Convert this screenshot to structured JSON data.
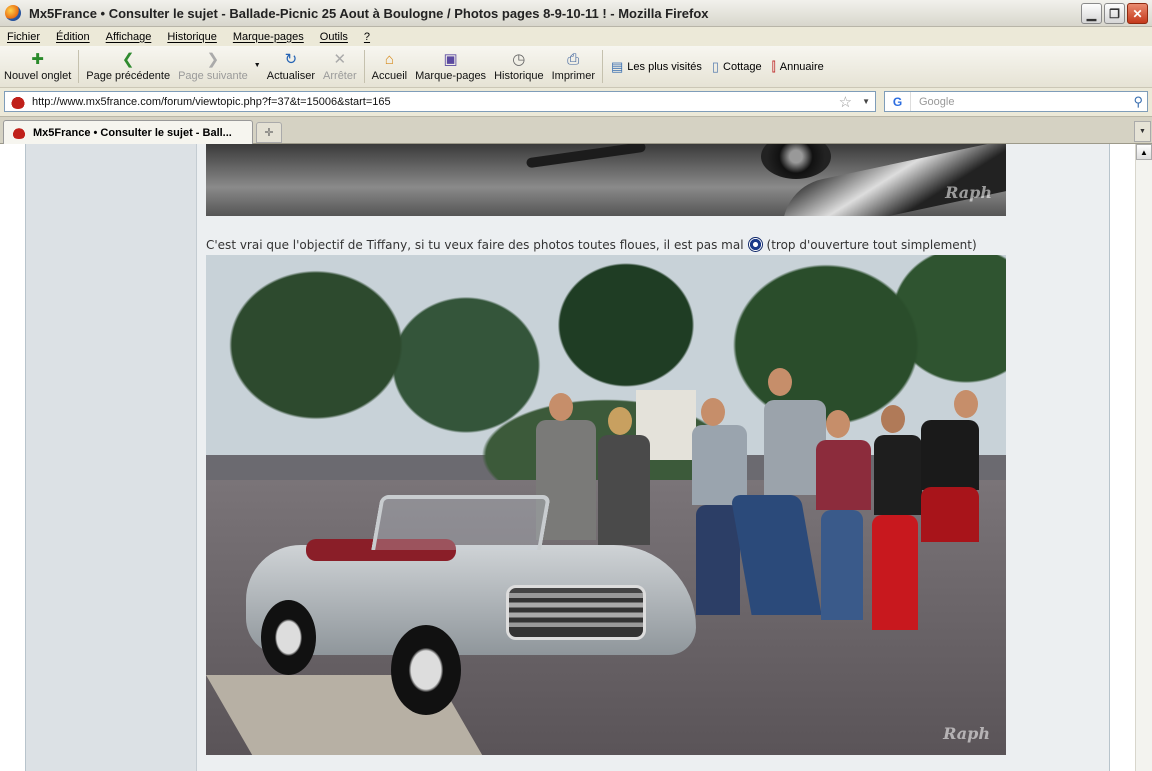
{
  "window": {
    "title": "Mx5France • Consulter le sujet - Ballade-Picnic 25 Aout à Boulogne / Photos pages 8-9-10-11 ! - Mozilla Firefox"
  },
  "menu": [
    "Fichier",
    "Édition",
    "Affichage",
    "Historique",
    "Marque-pages",
    "Outils",
    "?"
  ],
  "toolbar": {
    "new_tab": "Nouvel onglet",
    "back": "Page précédente",
    "forward": "Page suivante",
    "reload": "Actualiser",
    "stop": "Arrêter",
    "home": "Accueil",
    "bookmarks": "Marque-pages",
    "history": "Historique",
    "print": "Imprimer"
  },
  "bookmarks_bar": [
    "Les plus visités",
    "Cottage",
    "Annuaire"
  ],
  "address": {
    "url": "http://www.mx5france.com/forum/viewtopic.php?f=37&t=15006&start=165"
  },
  "search": {
    "placeholder": "Google"
  },
  "tab": {
    "title": "Mx5France • Consulter le sujet - Ball..."
  },
  "post": {
    "text_before": "C'est vrai que l'objectif de Tiffany, si tu veux faire des photos toutes floues, il est pas mal",
    "text_after": "(trop d'ouverture tout simplement)",
    "watermark": "Raph"
  },
  "icons": {
    "smiley": "smiley-icon",
    "home": "home-icon",
    "reload": "reload-icon"
  }
}
